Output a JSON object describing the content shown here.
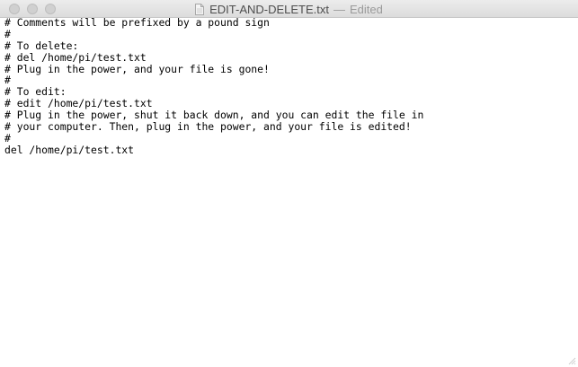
{
  "window": {
    "filename": "EDIT-AND-DELETE.txt",
    "separator": "—",
    "status": "Edited"
  },
  "icons": {
    "close": "close-button-icon",
    "minimize": "minimize-button-icon",
    "zoom": "zoom-button-icon",
    "document": "text-document-icon",
    "resize": "resize-grip-icon"
  },
  "colors": {
    "traffic_light_inactive": "#d0d0d0",
    "titlebar": "#e6e6e6",
    "text": "#000000",
    "title_text": "#4d4d4d",
    "status_text": "#9a9a9a"
  },
  "document": {
    "lines": [
      "# Comments will be prefixed by a pound sign",
      "#",
      "# To delete:",
      "# del /home/pi/test.txt",
      "# Plug in the power, and your file is gone!",
      "#",
      "# To edit:",
      "# edit /home/pi/test.txt",
      "# Plug in the power, shut it back down, and you can edit the file in",
      "# your computer. Then, plug in the power, and your file is edited!",
      "#",
      "del /home/pi/test.txt"
    ]
  }
}
